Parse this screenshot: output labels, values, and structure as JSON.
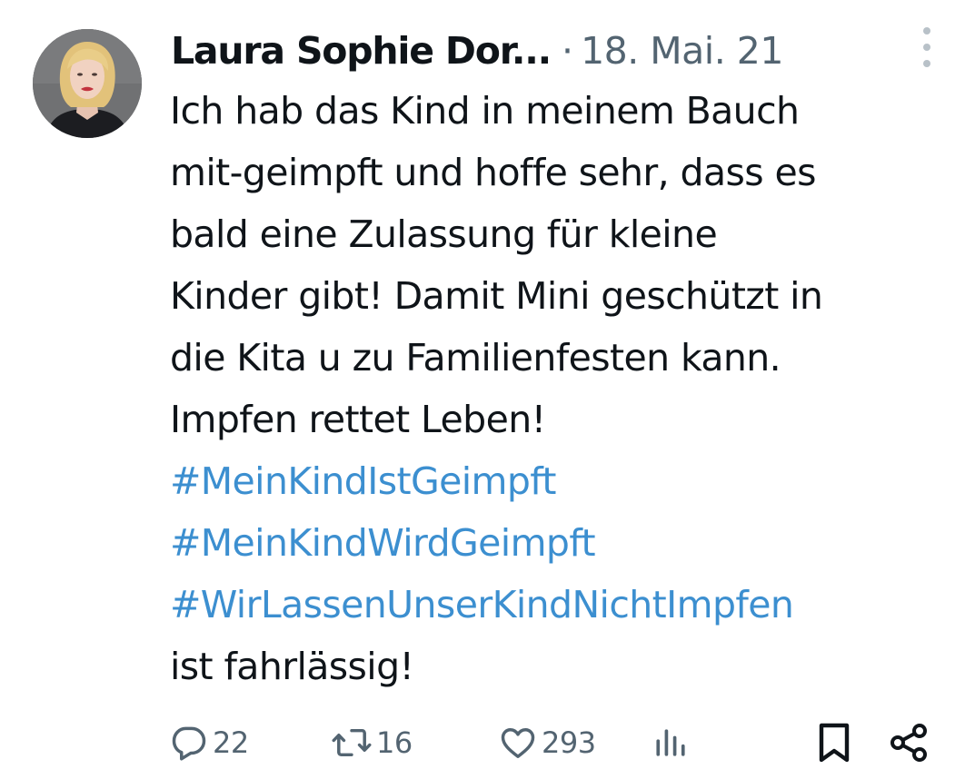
{
  "tweet": {
    "author_name": "Laura Sophie Dor...",
    "separator": "·",
    "timestamp": "18. Mai. 21",
    "body_lines": [
      "Ich hab das Kind in meinem Bauch",
      "mit-geimpft und hoffe sehr, dass es",
      "bald eine Zulassung für kleine",
      "Kinder gibt! Damit Mini geschützt in",
      "die Kita u zu Familienfesten kann.",
      "Impfen rettet Leben!"
    ],
    "hashtags": [
      "#MeinKindIstGeimpft",
      "#MeinKindWirdGeimpft",
      "#WirLassenUnserKindNichtImpfen"
    ],
    "closing_text": "ist fahrlässig!",
    "hashtag_color": "#3c8fd0"
  },
  "actions": {
    "reply_icon": "reply-icon",
    "reply_count": "22",
    "retweet_icon": "retweet-icon",
    "retweet_count": "16",
    "like_icon": "heart-icon",
    "like_count": "293",
    "views_icon": "views-chart-icon",
    "bookmark_icon": "bookmark-icon",
    "share_icon": "share-icon"
  },
  "colors": {
    "text": "#0f1419",
    "secondary": "#536471",
    "link": "#3c8fd0",
    "background": "#ffffff"
  }
}
